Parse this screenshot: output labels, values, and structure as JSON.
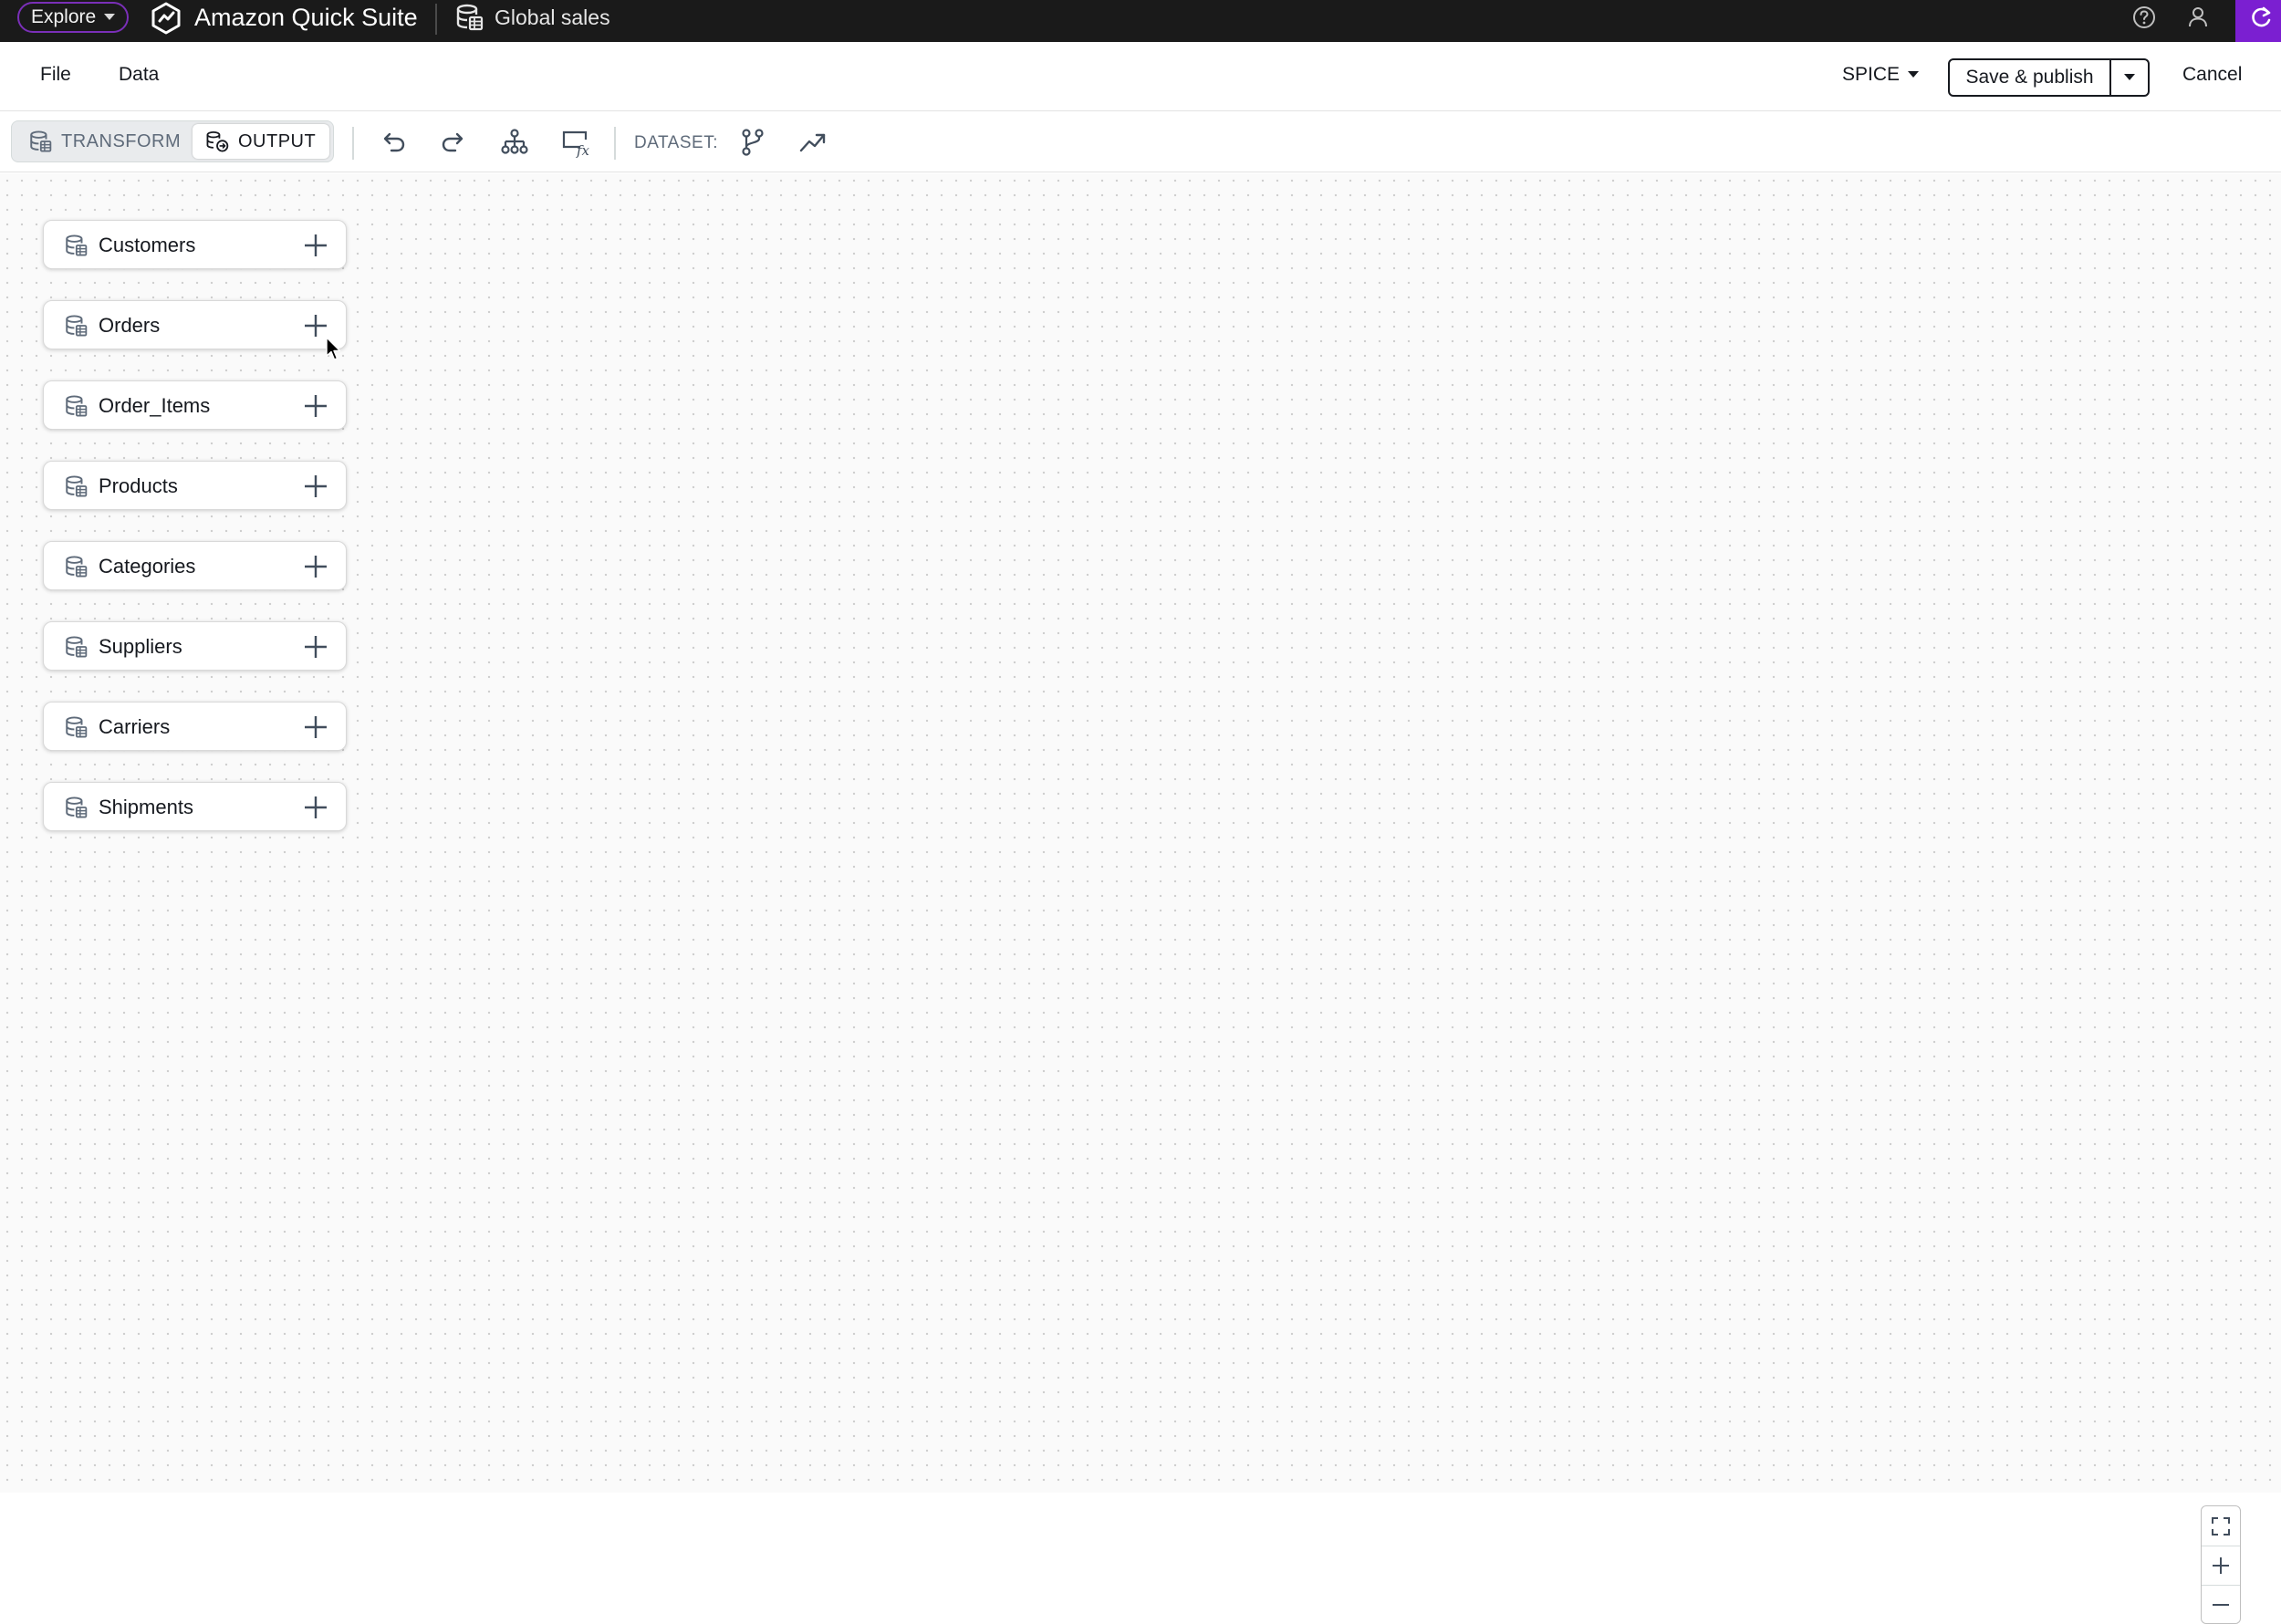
{
  "topbar": {
    "explore_label": "Explore",
    "product_name": "Amazon Quick Suite",
    "dataset_name": "Global sales"
  },
  "menubar": {
    "file_label": "File",
    "data_label": "Data",
    "storage_mode": "SPICE",
    "save_publish_label": "Save & publish",
    "cancel_label": "Cancel"
  },
  "toolbar": {
    "transform_label": "TRANSFORM",
    "output_label": "OUTPUT",
    "dataset_label": "DATASET:"
  },
  "tables": [
    {
      "label": "Customers"
    },
    {
      "label": "Orders"
    },
    {
      "label": "Order_Items"
    },
    {
      "label": "Products"
    },
    {
      "label": "Categories"
    },
    {
      "label": "Suppliers"
    },
    {
      "label": "Carriers"
    },
    {
      "label": "Shipments"
    }
  ],
  "colors": {
    "topbar_bg": "#1a1a1a",
    "accent_purple": "#7b1fd1",
    "text_primary": "#16191f",
    "text_secondary": "#5f6b7a"
  },
  "icons": {
    "explore_caret": "caret-down-icon",
    "logo": "quick-suite-logo-icon",
    "dataset": "database-icon",
    "help": "help-icon",
    "user": "user-icon",
    "undo": "undo-icon",
    "redo": "redo-icon",
    "hierarchy": "hierarchy-icon",
    "calc_field": "calculated-field-icon",
    "branch": "branch-icon",
    "trend": "trend-icon",
    "add": "plus-icon",
    "fit": "fit-screen-icon",
    "zoom_in": "zoom-in-icon",
    "zoom_out": "zoom-out-icon"
  }
}
